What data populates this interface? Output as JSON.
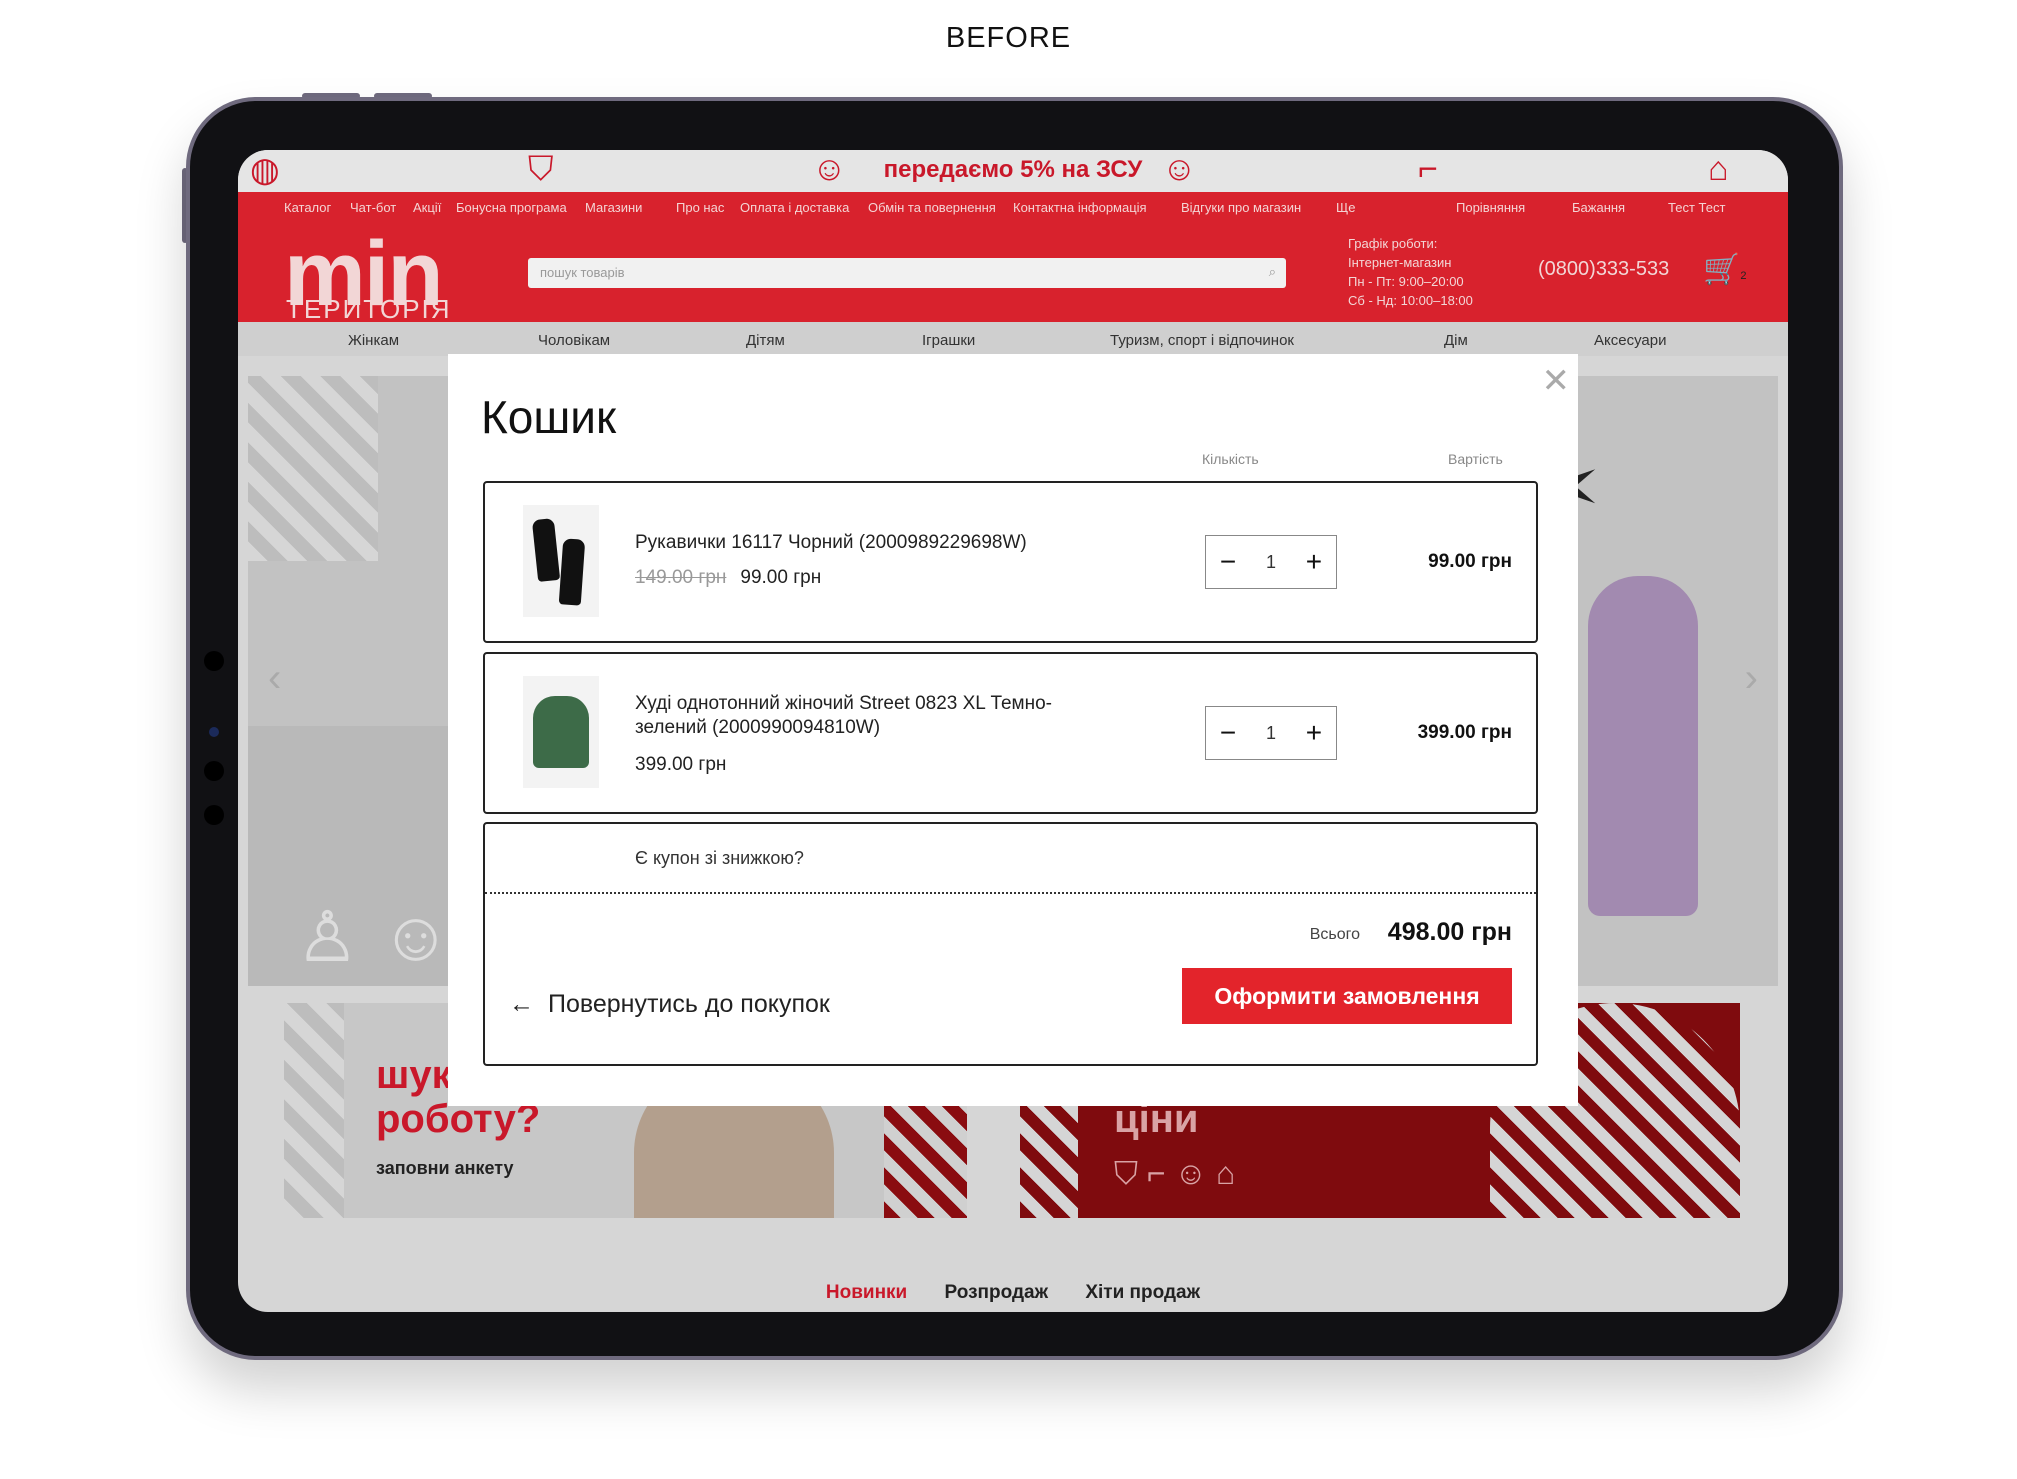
{
  "caption": "BEFORE",
  "site": {
    "promo_text": "передаємо 5% на ЗСУ",
    "top_nav": [
      "Каталог",
      "Чат-бот",
      "Акції",
      "Бонусна програма",
      "Магазини",
      "Про нас",
      "Оплата і доставка",
      "Обмін та повернення",
      "Контактна інформація",
      "Відгуки про магазин",
      "Ще"
    ],
    "top_right": {
      "compare": "Порівняння",
      "wishlist": "Бажання",
      "account": "Тест Тест"
    },
    "logo": {
      "main": "min",
      "sub": "ТЕРИТОРІЯ"
    },
    "search_placeholder": "пошук товарів",
    "schedule": {
      "title": "Графік роботи:",
      "shop": "Інтернет-магазин",
      "weekdays": "Пн - Пт: 9:00–20:00",
      "weekend": "Сб - Нд: 10:00–18:00"
    },
    "phone": "(0800)333-533",
    "cart_count": "2",
    "categories": [
      "Жінкам",
      "Чоловікам",
      "Дітям",
      "Іграшки",
      "Туризм, спорт і відпочинок",
      "Дім",
      "Аксесуари"
    ],
    "banners": {
      "left_title_1": "шук",
      "left_title_2": "роботу?",
      "left_sub": "заповни анкету",
      "right_title": "ціни"
    },
    "bottom_tabs": [
      "Новинки",
      "Розпродаж",
      "Хіти продаж"
    ]
  },
  "cart": {
    "title": "Кошик",
    "col_qty": "Кількість",
    "col_price": "Вартість",
    "items": [
      {
        "name": "Рукавички 16117 Чорний (2000989229698W)",
        "old_price": "149.00 грн",
        "price": "99.00 грн",
        "qty": "1",
        "total": "99.00 грн"
      },
      {
        "name": "Худі однотонний жіночий Street 0823 XL Темно-зелений (2000990094810W)",
        "old_price": "",
        "price": "399.00 грн",
        "qty": "1",
        "total": "399.00 грн"
      }
    ],
    "coupon_text": "Є купон зі знижкою?",
    "total_label": "Всього",
    "total_value": "498.00 грн",
    "back_label": "Повернутись до покупок",
    "checkout_label": "Оформити замовлення"
  }
}
